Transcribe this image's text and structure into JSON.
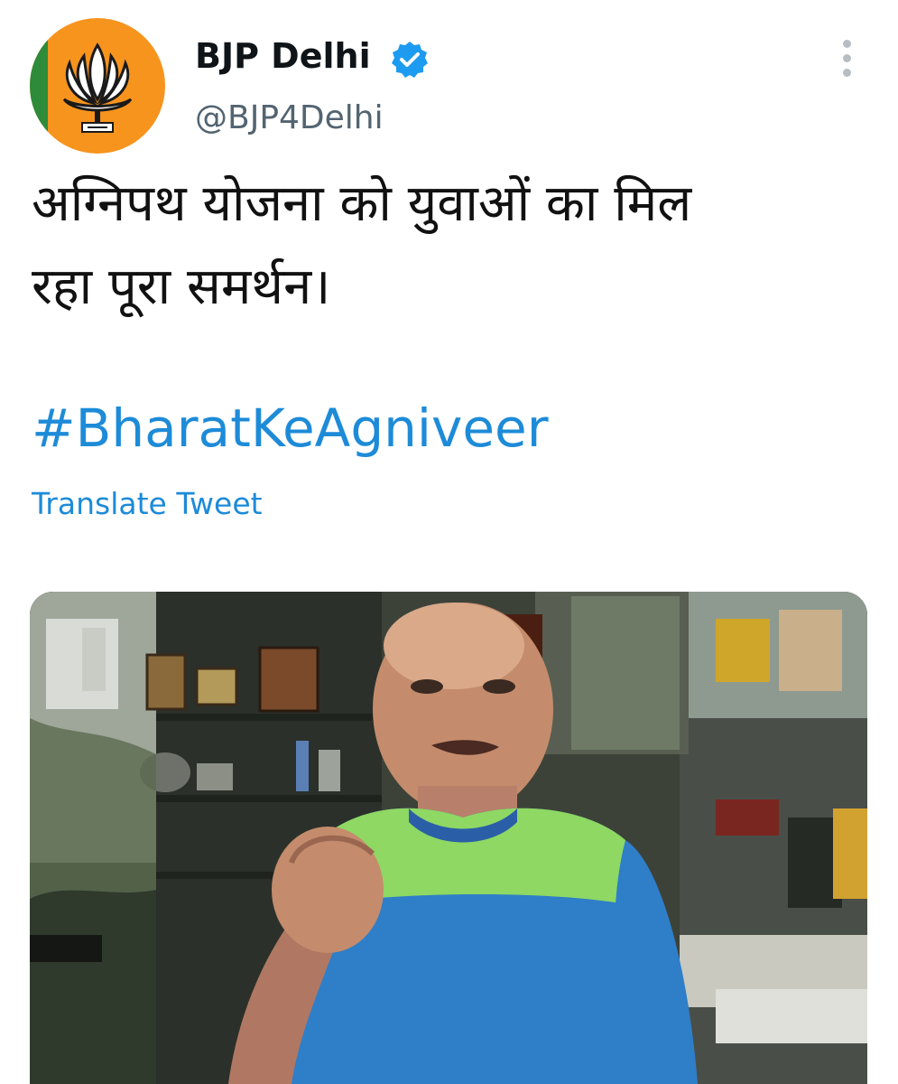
{
  "header": {
    "display_name": "BJP Delhi",
    "handle": "@BJP4Delhi",
    "verified": true,
    "avatar_icon": "lotus-logo-icon",
    "menu_icon": "more-vertical-icon"
  },
  "tweet": {
    "text_line1": "अग्निपथ योजना को युवाओं का मिल",
    "text_line2": "रहा पूरा समर्थन।",
    "hashtag": "#BharatKeAgniveer",
    "translate_label": "Translate Tweet"
  },
  "media": {
    "type": "video-thumbnail",
    "icon": "man-in-shop-photo"
  },
  "colors": {
    "link": "#1d8bd8",
    "verified_badge": "#1d9bf0",
    "avatar_bg": "#f7941d",
    "text": "#0f1419",
    "secondary_text": "#536471"
  }
}
